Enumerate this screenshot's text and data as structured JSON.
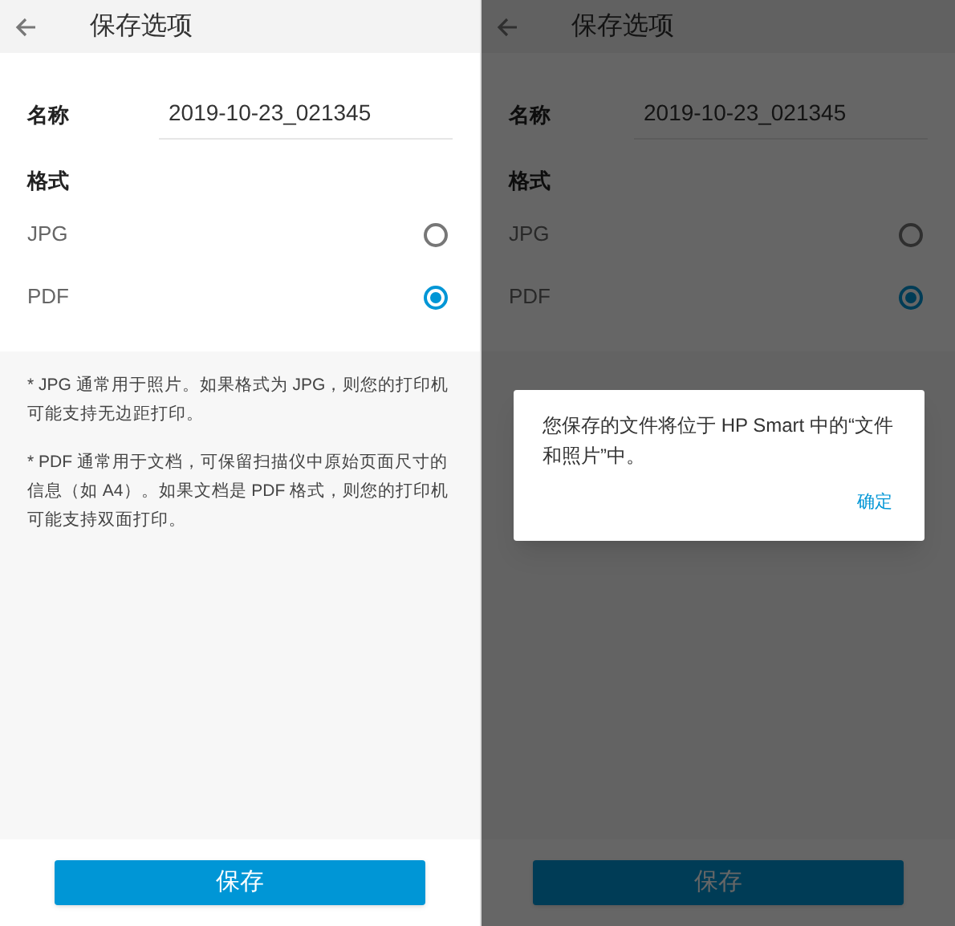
{
  "screens": [
    {
      "title": "保存选项",
      "name_label": "名称",
      "name_value": "2019-10-23_021345",
      "format_label": "格式",
      "options": [
        {
          "label": "JPG",
          "selected": false
        },
        {
          "label": "PDF",
          "selected": true
        }
      ],
      "notes": [
        "* JPG 通常用于照片。如果格式为 JPG，则您的打印机可能支持无边距打印。",
        "* PDF 通常用于文档，可保留扫描仪中原始页面尺寸的信息（如 A4）。如果文档是 PDF 格式，则您的打印机可能支持双面打印。"
      ],
      "save_button": "保存",
      "dimmed": false
    },
    {
      "title": "保存选项",
      "name_label": "名称",
      "name_value": "2019-10-23_021345",
      "format_label": "格式",
      "options": [
        {
          "label": "JPG",
          "selected": false
        },
        {
          "label": "PDF",
          "selected": true
        }
      ],
      "save_button": "保存",
      "dimmed": true,
      "dialog": {
        "message": "您保存的文件将位于 HP Smart 中的“文件和照片”中。",
        "confirm": "确定"
      }
    }
  ]
}
